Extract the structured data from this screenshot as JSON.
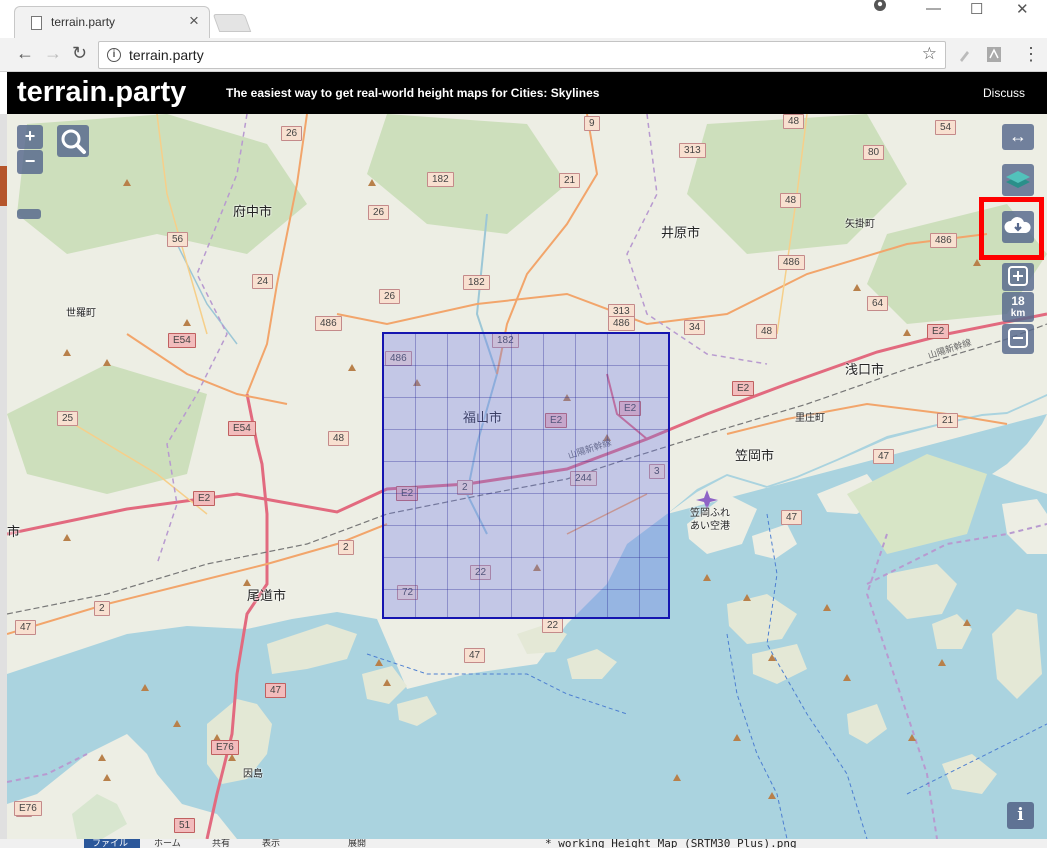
{
  "browser": {
    "tab_title": "terrain.party",
    "tab_close": "×",
    "url": "terrain.party",
    "back": "←",
    "forward": "→",
    "reload": "↻",
    "star": "☆",
    "menu": "⋮",
    "window_minimize": "—",
    "window_maximize": "☐",
    "window_close": "✕"
  },
  "header": {
    "brand": "terrain.party",
    "tagline": "The easiest way to get real-world height maps for Cities: Skylines",
    "discuss": "Discuss"
  },
  "controls": {
    "zoom_in": "+",
    "zoom_out": "−",
    "size_km": "18",
    "size_unit": "km",
    "resize_arrows": "↔",
    "info": "i"
  },
  "map": {
    "cities": [
      {
        "name": "府中市",
        "small": false
      },
      {
        "name": "井原市",
        "small": false
      },
      {
        "name": "世羅町",
        "small": true
      },
      {
        "name": "矢掛町",
        "small": true
      },
      {
        "name": "福山市",
        "small": false
      },
      {
        "name": "笠岡市",
        "small": false
      },
      {
        "name": "里庄町",
        "small": true
      },
      {
        "name": "浅口市",
        "small": false
      },
      {
        "name": "尾道市",
        "small": false
      },
      {
        "name": "因島",
        "small": true
      },
      {
        "name": "笠岡ふれ",
        "small": true
      },
      {
        "name": "あい空港",
        "small": true
      },
      {
        "name": "市",
        "small": false
      }
    ],
    "rail_label": "山陽新幹線",
    "rail_label_2": "山陽新幹線",
    "roads": [
      "26",
      "9",
      "48",
      "54",
      "313",
      "80",
      "182",
      "21",
      "56",
      "26",
      "48",
      "486",
      "24",
      "486",
      "182",
      "26",
      "313",
      "486",
      "486",
      "34",
      "64",
      "48",
      "E54",
      "182",
      "E2",
      "486",
      "E2",
      "E2",
      "25",
      "E54",
      "48",
      "E2",
      "21",
      "47",
      "244",
      "3",
      "47",
      "E2",
      "2",
      "2",
      "E2",
      "22",
      "72",
      "47",
      "2",
      "47",
      "22",
      "2",
      "47",
      "E76",
      "E76",
      "51",
      "E76"
    ]
  },
  "taskbar": {
    "file_tab": "ファイル",
    "home_tab": "ホーム",
    "share_tab": "共有",
    "view_tab": "表示",
    "expand": "展開",
    "document_name": "* working Height Map (SRTM30 Plus).png"
  },
  "colors": {
    "header_bg": "#000000",
    "water": "#aad3df",
    "selection_border": "#1515b0",
    "highlight": "#ff0000",
    "control_bg": "#56688c"
  }
}
